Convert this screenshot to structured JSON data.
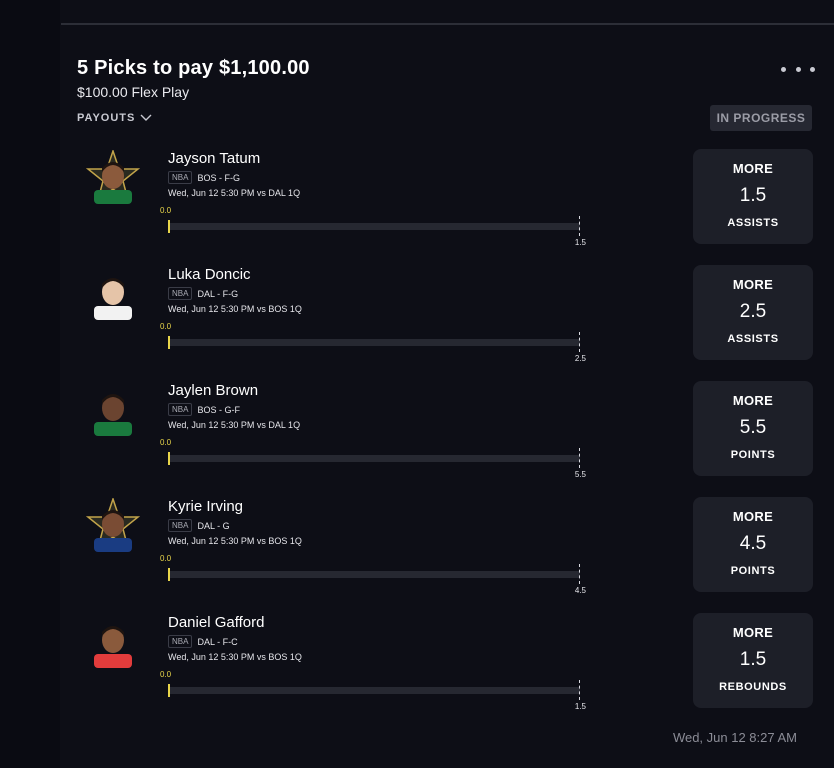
{
  "header": {
    "title": "5 Picks to pay $1,100.00",
    "subtitle": "$100.00 Flex Play",
    "payouts_label": "PAYOUTS",
    "status": "IN PROGRESS"
  },
  "picks": [
    {
      "name": "Jayson Tatum",
      "league": "NBA",
      "position": "BOS - F-G",
      "game": "Wed, Jun 12 5:30 PM  vs DAL 1Q",
      "current": "0.0",
      "target": "1.5",
      "direction": "MORE",
      "line": "1.5",
      "stat": "ASSISTS",
      "avatar": "player-star-avatar",
      "progress": 0
    },
    {
      "name": "Luka Doncic",
      "league": "NBA",
      "position": "DAL - F-G",
      "game": "Wed, Jun 12 5:30 PM  vs BOS 1Q",
      "current": "0.0",
      "target": "2.5",
      "direction": "MORE",
      "line": "2.5",
      "stat": "ASSISTS",
      "avatar": "player-avatar",
      "progress": 0
    },
    {
      "name": "Jaylen Brown",
      "league": "NBA",
      "position": "BOS - G-F",
      "game": "Wed, Jun 12 5:30 PM  vs DAL 1Q",
      "current": "0.0",
      "target": "5.5",
      "direction": "MORE",
      "line": "5.5",
      "stat": "POINTS",
      "avatar": "player-avatar",
      "progress": 0
    },
    {
      "name": "Kyrie Irving",
      "league": "NBA",
      "position": "DAL - G",
      "game": "Wed, Jun 12 5:30 PM  vs BOS 1Q",
      "current": "0.0",
      "target": "4.5",
      "direction": "MORE",
      "line": "4.5",
      "stat": "POINTS",
      "avatar": "player-star-avatar",
      "progress": 0
    },
    {
      "name": "Daniel Gafford",
      "league": "NBA",
      "position": "DAL - F-C",
      "game": "Wed, Jun 12 5:30 PM  vs BOS 1Q",
      "current": "0.0",
      "target": "1.5",
      "direction": "MORE",
      "line": "1.5",
      "stat": "REBOUNDS",
      "avatar": "player-avatar",
      "progress": 0
    }
  ],
  "footer": {
    "timestamp": "Wed, Jun 12 8:27 AM"
  },
  "colors": {
    "background": "#0d0e16",
    "card": "#1d1f28",
    "accent": "#e8d54a",
    "muted": "#8b8c96"
  }
}
